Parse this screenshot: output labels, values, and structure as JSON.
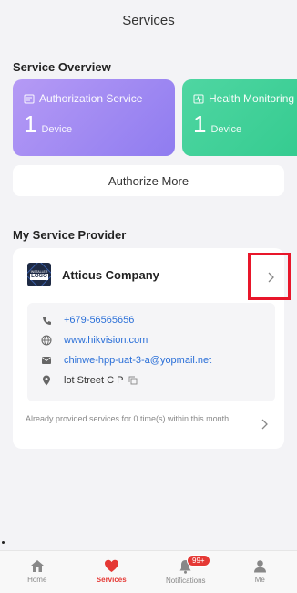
{
  "header": {
    "title": "Services"
  },
  "overview": {
    "title": "Service Overview",
    "cards": [
      {
        "name": "Authorization Service",
        "count": "1",
        "unit": "Device",
        "icon": "id-card-icon"
      },
      {
        "name": "Health Monitoring",
        "count": "1",
        "unit": "Device",
        "icon": "health-monitor-icon"
      }
    ],
    "authorize_label": "Authorize More"
  },
  "provider": {
    "title": "My Service Provider",
    "logo_top": "INSTALLER",
    "logo_main": "LOGO",
    "company": "Atticus Company",
    "phone": "+679-56565656",
    "website": "www.hikvision.com",
    "email": "chinwe-hpp-uat-3-a@yopmail.net",
    "address": "lot Street C P",
    "note": "Already provided services for 0 time(s) within this month."
  },
  "tabs": [
    {
      "label": "Home",
      "icon": "home-icon"
    },
    {
      "label": "Services",
      "icon": "heart-icon"
    },
    {
      "label": "Notifications",
      "icon": "bell-icon",
      "badge": "99+"
    },
    {
      "label": "Me",
      "icon": "person-icon"
    }
  ],
  "colors": {
    "accent": "#e53935",
    "auth_card": "#9d86f2",
    "health_card": "#3dcf95",
    "link": "#2a6fd8",
    "highlight": "#e8162a"
  }
}
